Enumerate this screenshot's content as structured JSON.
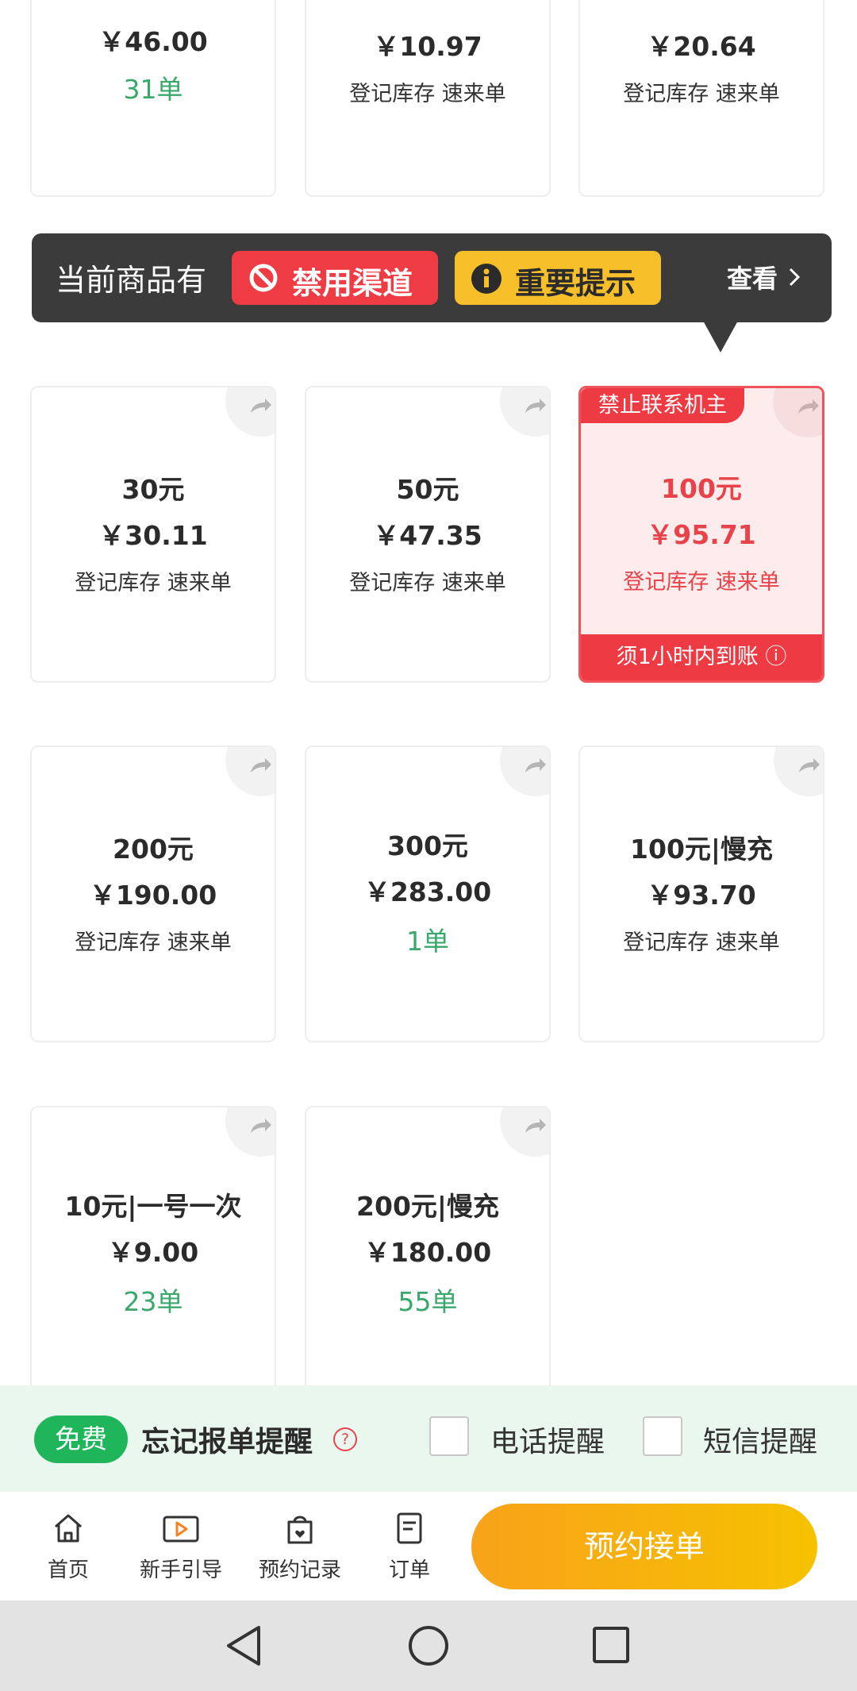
{
  "products_top_partial": [
    {
      "price": "￥46.00",
      "orders": "31单"
    },
    {
      "price": "￥10.97",
      "stock_note": "登记库存 速来单"
    },
    {
      "price": "￥20.64",
      "stock_note": "登记库存 速来单"
    }
  ],
  "banner": {
    "prefix": "当前商品有",
    "banned_label": "禁用渠道",
    "important_label": "重要提示",
    "view_label": "查看",
    "colors": {
      "background": "#3b3b3b",
      "banned": "#ef3b43",
      "important": "#f7c02b"
    }
  },
  "products": [
    {
      "title": "30元",
      "price": "￥30.11",
      "stock_note": "登记库存 速来单"
    },
    {
      "title": "50元",
      "price": "￥47.35",
      "stock_note": "登记库存 速来单"
    },
    {
      "title": "100元",
      "price": "￥95.71",
      "stock_note": "登记库存 速来单",
      "top_tag": "禁止联系机主",
      "bottom_tag": "须1小时内到账 ⓘ",
      "selected": true
    },
    {
      "title": "200元",
      "price": "￥190.00",
      "stock_note": "登记库存 速来单"
    },
    {
      "title": "300元",
      "price": "￥283.00",
      "orders": "1单"
    },
    {
      "title": "100元|慢充",
      "price": "￥93.70",
      "stock_note": "登记库存 速来单"
    },
    {
      "title": "10元|一号一次",
      "price": "￥9.00",
      "orders": "23单"
    },
    {
      "title": "200元|慢充",
      "price": "￥180.00",
      "orders": "55单"
    }
  ],
  "reminder": {
    "free_badge": "免费",
    "title": "忘记报单提醒",
    "help_icon": "?",
    "phone_label": "电话提醒",
    "sms_label": "短信提醒"
  },
  "tabbar": {
    "items": [
      {
        "label": "首页",
        "icon": "home-icon"
      },
      {
        "label": "新手引导",
        "icon": "video-play-icon"
      },
      {
        "label": "预约记录",
        "icon": "bag-heart-icon"
      },
      {
        "label": "订单",
        "icon": "order-list-icon"
      }
    ],
    "cta_label": "预约接单"
  },
  "colors": {
    "accent_green": "#3aa86b",
    "alert_red": "#ee3a43",
    "cta_orange": "#f8a21a"
  }
}
